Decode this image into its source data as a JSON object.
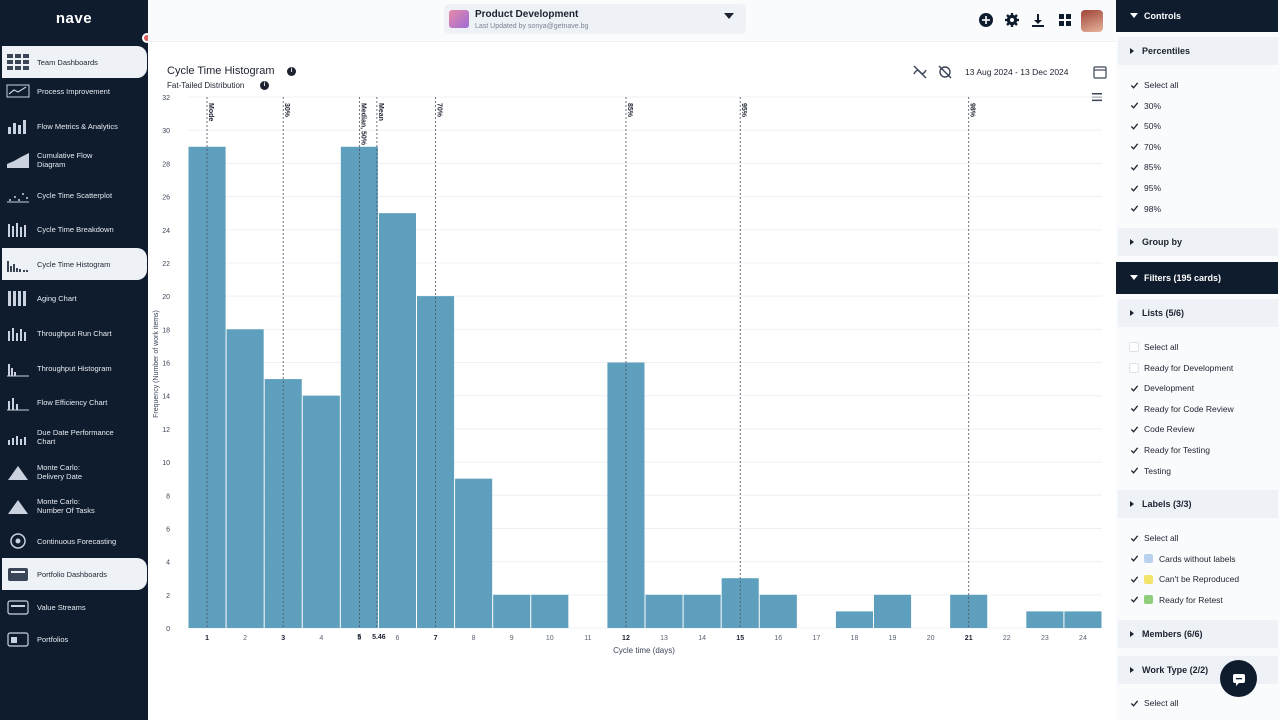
{
  "app": {
    "logo": "nave"
  },
  "sidebar": {
    "items": [
      {
        "label": "Team Dashboards",
        "icon": "grid-dashboard-icon",
        "active": true
      },
      {
        "label": "Process Improvement",
        "icon": "process-improvement-icon"
      },
      {
        "label": "Flow Metrics & Analytics",
        "icon": "bar-chart-icon"
      },
      {
        "label": "Cumulative Flow Diagram",
        "icon": "cumulative-flow-icon"
      },
      {
        "label": "Cycle Time Scatterplot",
        "icon": "scatterplot-icon"
      },
      {
        "label": "Cycle Time Breakdown",
        "icon": "breakdown-icon"
      },
      {
        "label": "Cycle Time Histogram",
        "icon": "histogram-icon",
        "active": true
      },
      {
        "label": "Aging Chart",
        "icon": "aging-chart-icon"
      },
      {
        "label": "Throughput Run Chart",
        "icon": "run-chart-icon"
      },
      {
        "label": "Throughput Histogram",
        "icon": "throughput-histogram-icon"
      },
      {
        "label": "Flow Efficiency Chart",
        "icon": "flow-efficiency-icon"
      },
      {
        "label": "Due Date Performance Chart",
        "icon": "due-date-icon"
      },
      {
        "label": "Monte Carlo: Delivery Date",
        "icon": "monte-carlo-date-icon"
      },
      {
        "label": "Monte Carlo: Number Of Tasks",
        "icon": "monte-carlo-tasks-icon"
      },
      {
        "label": "Continuous Forecasting",
        "icon": "forecasting-icon"
      },
      {
        "label": "Portfolio Dashboards",
        "icon": "portfolio-dashboards-icon",
        "active": true
      },
      {
        "label": "Value Streams",
        "icon": "value-streams-icon"
      },
      {
        "label": "Portfolios",
        "icon": "portfolios-icon"
      }
    ]
  },
  "header": {
    "board_title": "Product Development",
    "board_subtitle": "Last Updated by sonya@getnave.bg",
    "icons": [
      "add-icon",
      "settings-icon",
      "download-icon",
      "layout-icon",
      "avatar"
    ]
  },
  "chart_header": {
    "title": "Cycle Time Histogram",
    "subtitle": "Fat-Tailed Distribution",
    "date_range": "13 Aug 2024 - 13 Dec 2024"
  },
  "chart_data": {
    "type": "bar",
    "title": "Cycle Time Histogram",
    "xlabel": "Cycle time (days)",
    "ylabel": "Frequency (Number of work items)",
    "ylim": [
      0,
      32
    ],
    "yticks": [
      0,
      2,
      4,
      6,
      8,
      10,
      12,
      14,
      16,
      18,
      20,
      22,
      24,
      26,
      28,
      30,
      32
    ],
    "categories": [
      "1",
      "2",
      "3",
      "4",
      "5",
      "6",
      "7",
      "8",
      "9",
      "10",
      "11",
      "12",
      "13",
      "14",
      "15",
      "16",
      "17",
      "18",
      "19",
      "20",
      "21",
      "22",
      "23",
      "24"
    ],
    "values": [
      29,
      18,
      15,
      14,
      29,
      25,
      20,
      9,
      2,
      2,
      0,
      16,
      2,
      2,
      3,
      2,
      0,
      1,
      2,
      0,
      2,
      0,
      1,
      1
    ],
    "color": "#5d9fbc",
    "bold_ticks": [
      "1",
      "3",
      "7",
      "12",
      "15",
      "21"
    ],
    "extra_ticks": [
      {
        "x": 5.0,
        "label": "5"
      },
      {
        "x": 5.46,
        "label": "5.46"
      }
    ],
    "reference_lines": [
      {
        "label": "Mode",
        "x": 1
      },
      {
        "label": "30%",
        "x": 3
      },
      {
        "label": "Median, 50%",
        "x": 5
      },
      {
        "label": "Mean",
        "x": 5.46
      },
      {
        "label": "70%",
        "x": 7
      },
      {
        "label": "85%",
        "x": 12
      },
      {
        "label": "95%",
        "x": 15
      },
      {
        "label": "98%",
        "x": 21
      }
    ],
    "grid": true
  },
  "controls": {
    "title": "Controls",
    "percentiles": {
      "title": "Percentiles",
      "options": [
        {
          "label": "Select all",
          "checked": true
        },
        {
          "label": "30%",
          "checked": true
        },
        {
          "label": "50%",
          "checked": true
        },
        {
          "label": "70%",
          "checked": true
        },
        {
          "label": "85%",
          "checked": true
        },
        {
          "label": "95%",
          "checked": true
        },
        {
          "label": "98%",
          "checked": true
        }
      ]
    },
    "group_by": {
      "title": "Group by"
    },
    "filters": {
      "title": "Filters (195 cards)",
      "lists": {
        "title": "Lists  (5/6)",
        "options": [
          {
            "label": "Select all",
            "checked": false
          },
          {
            "label": "Ready for Development",
            "checked": false
          },
          {
            "label": "Development",
            "checked": true
          },
          {
            "label": "Ready for Code Review",
            "checked": true
          },
          {
            "label": "Code Review",
            "checked": true
          },
          {
            "label": "Ready for Testing",
            "checked": true
          },
          {
            "label": "Testing",
            "checked": true
          }
        ]
      },
      "labels": {
        "title": "Labels  (3/3)",
        "options": [
          {
            "label": "Select all",
            "checked": true
          },
          {
            "label": "Cards without labels",
            "checked": true,
            "color": "#b9d3ee"
          },
          {
            "label": "Can't be Reproduced",
            "checked": true,
            "color": "#f2e36b"
          },
          {
            "label": "Ready for Retest",
            "checked": true,
            "color": "#8fcf7c"
          }
        ]
      },
      "members": {
        "title": "Members  (6/6)"
      },
      "work_type": {
        "title": "Work Type  (2/2)",
        "options": [
          {
            "label": "Select all",
            "checked": true
          }
        ]
      }
    }
  }
}
